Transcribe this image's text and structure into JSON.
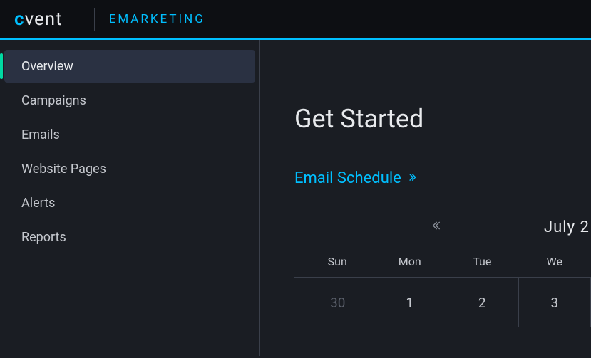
{
  "header": {
    "logo_prefix": "c",
    "logo_suffix": "vent",
    "product": "EMARKETING"
  },
  "sidebar": {
    "items": [
      {
        "label": "Overview",
        "active": true
      },
      {
        "label": "Campaigns",
        "active": false
      },
      {
        "label": "Emails",
        "active": false
      },
      {
        "label": "Website Pages",
        "active": false
      },
      {
        "label": "Alerts",
        "active": false
      },
      {
        "label": "Reports",
        "active": false
      }
    ]
  },
  "main": {
    "title": "Get Started",
    "section_link": "Email Schedule",
    "calendar": {
      "month_label": "July 2",
      "day_headers": [
        "Sun",
        "Mon",
        "Tue",
        "We"
      ],
      "dates_row1": [
        "30",
        "1",
        "2",
        "3"
      ]
    }
  }
}
